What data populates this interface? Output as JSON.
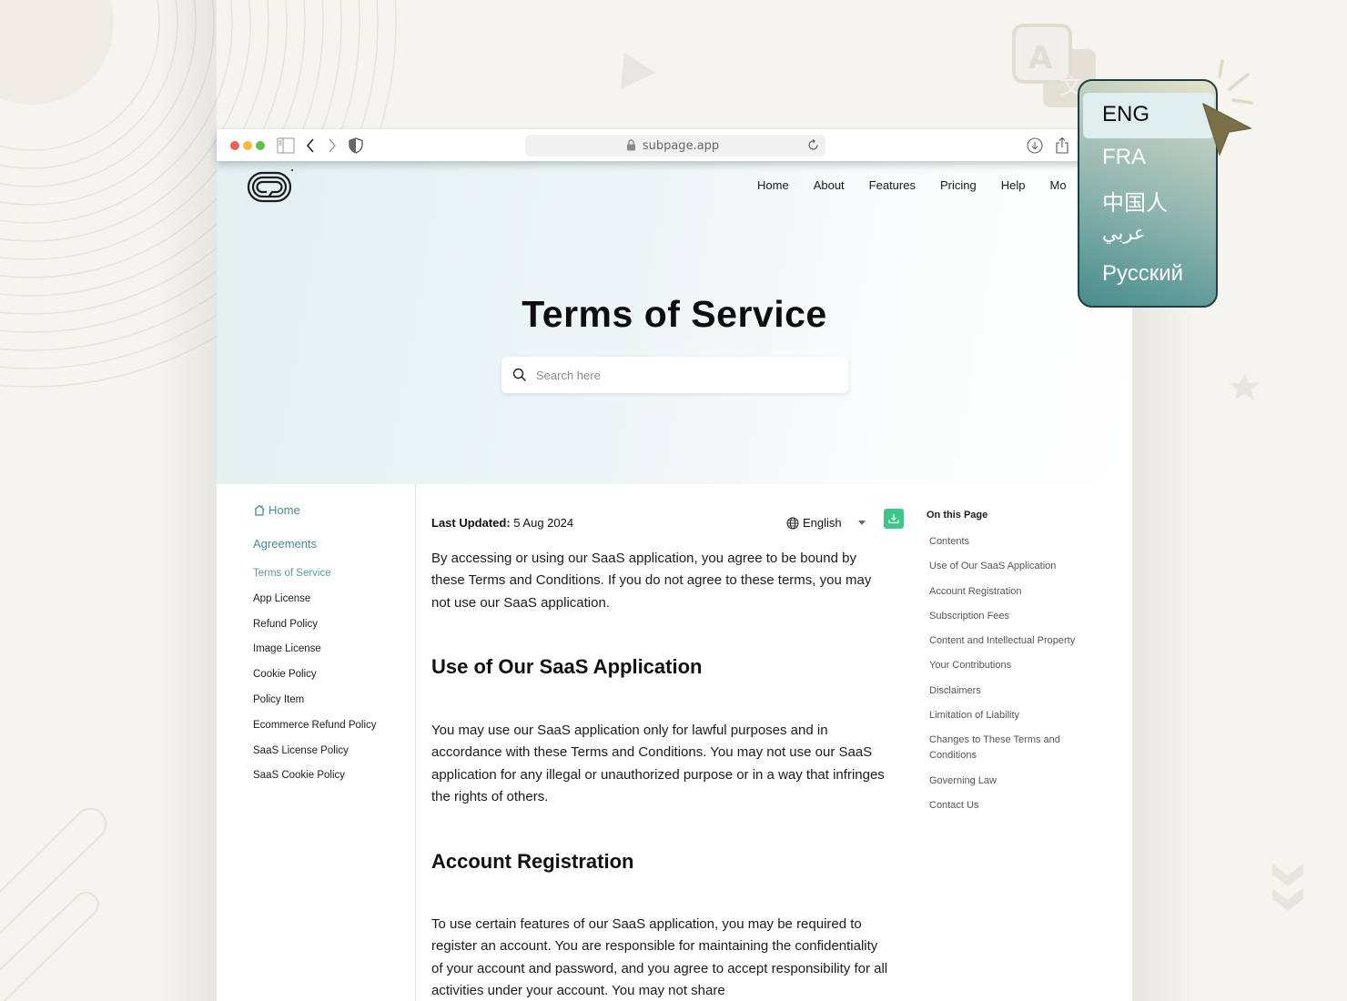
{
  "browser": {
    "url": "subpage.app",
    "icons": [
      "sidebar-icon",
      "back-icon",
      "forward-icon",
      "shield-icon",
      "lock-icon",
      "reload-icon",
      "download-icon",
      "share-icon"
    ]
  },
  "header": {
    "nav": [
      "Home",
      "About",
      "Features",
      "Pricing",
      "Help",
      "Mo"
    ]
  },
  "hero": {
    "title": "Terms of Service",
    "search_placeholder": "Search here",
    "search_value": ""
  },
  "sidebar": {
    "home_label": "Home",
    "section_label": "Agreements",
    "items": [
      {
        "label": "Terms of Service",
        "active": true
      },
      {
        "label": "App License"
      },
      {
        "label": "Refund Policy"
      },
      {
        "label": "Image License"
      },
      {
        "label": "Cookie Policy"
      },
      {
        "label": "Policy Item"
      },
      {
        "label": "Ecommerce Refund Policy"
      },
      {
        "label": "SaaS License Policy"
      },
      {
        "label": "SaaS Cookie Policy"
      }
    ]
  },
  "main": {
    "last_updated_label": "Last Updated:",
    "last_updated_value": "5 Aug 2024",
    "language": "English",
    "intro": "By accessing or using our SaaS application, you agree to be bound by these Terms and Conditions. If you do not agree to these terms, you may not use our SaaS application.",
    "sections": [
      {
        "heading": "Use of Our SaaS Application",
        "body": "You may use our SaaS application only for lawful purposes and in accordance with these Terms and Conditions. You may not use our SaaS application for any illegal or unauthorized purpose or in a way that infringes the rights of others."
      },
      {
        "heading": "Account Registration",
        "body": "To use certain features of our SaaS application, you may be required to register an account. You are responsible for maintaining the confidentiality of your account and password, and you agree to accept responsibility for all activities under your account. You may not share"
      }
    ]
  },
  "toc": {
    "title": "On this Page",
    "items": [
      "Contents",
      "Use of Our SaaS Application",
      "Account Registration",
      "Subscription Fees",
      "Content and Intellectual Property",
      "Your Contributions",
      "Disclaimers",
      "Limitation of Liability",
      "Changes to These Terms and Conditions",
      "Governing Law",
      "Contact Us"
    ]
  },
  "language_popup": {
    "options": [
      "ENG",
      "FRA",
      "中国人",
      "عربي",
      "Русский"
    ],
    "selected": "ENG"
  },
  "colors": {
    "accent_teal": "#4a8a91",
    "download_green": "#3dc68a",
    "popup_border": "#1f3e42",
    "cursor": "#7a7048"
  }
}
